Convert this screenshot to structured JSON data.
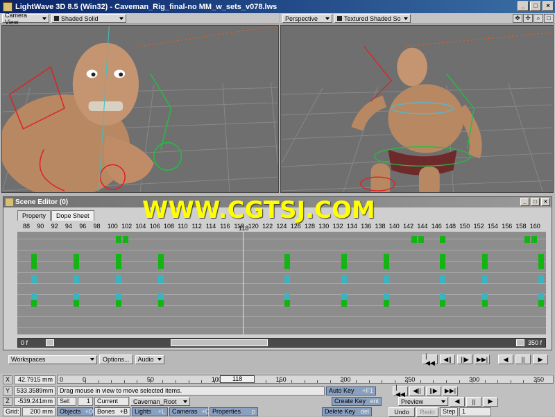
{
  "window": {
    "title": "LightWave 3D 8.5 (Win32) - Caveman_Rig_final-no MM_w_sets_v078.lws"
  },
  "left_viewport": {
    "view": "Camera View",
    "shading": "Shaded Solid"
  },
  "right_viewport": {
    "view": "Perspective",
    "shading": "Textured Shaded Solid"
  },
  "scene_editor": {
    "title": "Scene Editor (0)",
    "tabs": [
      "Property",
      "Dope Sheet"
    ],
    "frame_ticks": [
      "88",
      "90",
      "92",
      "94",
      "96",
      "98",
      "100",
      "102",
      "104",
      "106",
      "108",
      "110",
      "112",
      "114",
      "116",
      "118",
      "120",
      "122",
      "124",
      "126",
      "128",
      "130",
      "132",
      "134",
      "136",
      "138",
      "140",
      "142",
      "144",
      "146",
      "148",
      "150",
      "152",
      "154",
      "156",
      "158",
      "160"
    ],
    "current_frame": "118",
    "range_start": "0 f",
    "range_end": "350 f"
  },
  "watermark": "WWW.CGTSJ.COM",
  "controls": {
    "workspaces": "Workspaces",
    "options": "Options...",
    "audio": "Audio",
    "transport_left": [
      "|◀◀",
      "◀||",
      "||▶",
      "▶▶|"
    ],
    "transport_right": [
      "◀",
      "||",
      "▶"
    ]
  },
  "bottom": {
    "x_label": "X",
    "y_label": "Y",
    "z_label": "Z",
    "x_value": "42.7915 mm",
    "y_value": "533.3589mm",
    "z_value": "-539.241mm",
    "grid_label": "Grid:",
    "grid_value": "200 mm",
    "status": "Drag mouse in view to move selected items.",
    "timeline_start": "0",
    "timeline_end": "350",
    "timeline_labels": [
      "0",
      "50",
      "100",
      "150",
      "200",
      "250",
      "300",
      "350"
    ],
    "timeline_current": "118",
    "sel_label": "Sel:",
    "sel_value": "1",
    "current_item_label": "Current Item",
    "current_item": "Caveman_Root",
    "auto_key": "Auto Key",
    "auto_key_sc": "+F1",
    "create_key": "Create Key",
    "create_key_sc": "ent",
    "delete_key": "Delete Key",
    "delete_key_sc": "del",
    "preview": "Preview",
    "undo": "Undo",
    "redo": "Redo",
    "step_label": "Step",
    "step_value": "1",
    "modes": [
      {
        "label": "Objects",
        "sc": "+O"
      },
      {
        "label": "Bones",
        "sc": "+B"
      },
      {
        "label": "Lights",
        "sc": "+L"
      },
      {
        "label": "Cameras",
        "sc": "+C"
      },
      {
        "label": "Properties",
        "sc": "p"
      }
    ]
  }
}
